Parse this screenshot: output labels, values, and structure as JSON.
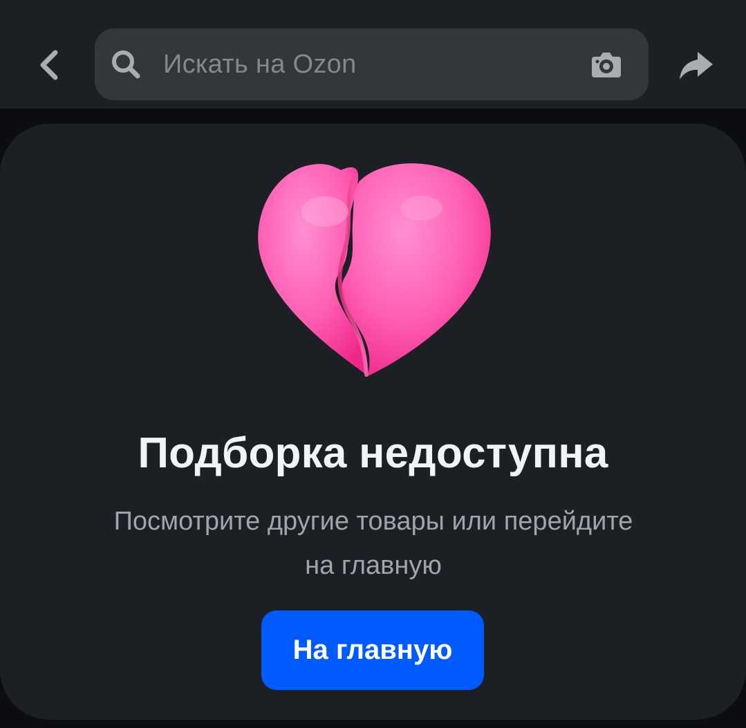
{
  "header": {
    "back_icon": "chevron-left-icon",
    "search": {
      "placeholder": "Искать на Ozon",
      "search_icon": "search-icon",
      "camera_icon": "camera-icon"
    },
    "share_icon": "share-icon"
  },
  "empty_state": {
    "illustration": "broken-heart-icon",
    "title": "Подборка недоступна",
    "subtitle_line1": "Посмотрите другие товары или перейдите",
    "subtitle_line2": "на главную",
    "button_label": "На главную"
  },
  "colors": {
    "accent": "#005bff",
    "surface": "#1c1f24",
    "heart": "#ff4fa3"
  }
}
